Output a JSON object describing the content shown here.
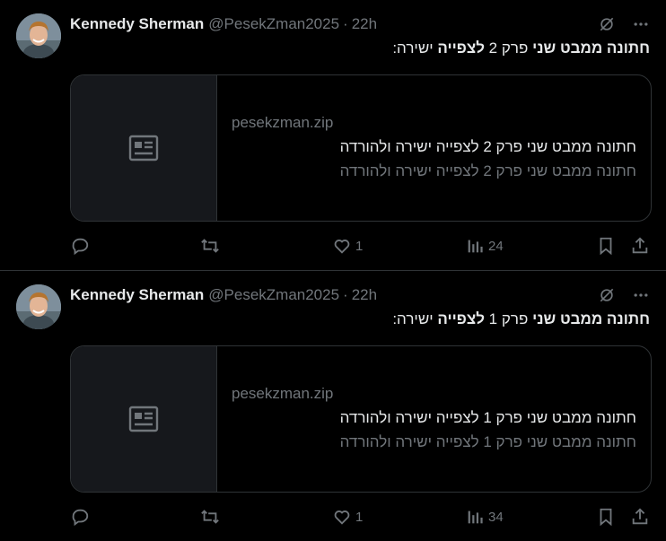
{
  "colors": {
    "background": "#000000",
    "divider": "#2f3336",
    "text_primary": "#e7e9ea",
    "text_secondary": "#71767b",
    "card_thumb": "#16181c"
  },
  "tweets": [
    {
      "author_name": "Kennedy Sherman",
      "author_handle": "@PesekZman2025",
      "separator": "·",
      "time": "22h",
      "text_bold_1": "חתונה ממבט שני",
      "text_mid": " פרק 2 ",
      "text_bold_2": "לצפייה",
      "text_end": " ישירה:",
      "card": {
        "domain": "pesekzman.zip",
        "title": "חתונה ממבט שני פרק 2 לצפייה ישירה ולהורדה",
        "description": "חתונה ממבט שני פרק 2 לצפייה ישירה ולהורדה"
      },
      "actions": {
        "replies": "",
        "retweets": "",
        "likes": "1",
        "views": "24"
      },
      "icons": {
        "grok": "grok-icon",
        "more": "more-icon",
        "reply": "reply-icon",
        "retweet": "retweet-icon",
        "like": "heart-icon",
        "views": "views-icon",
        "bookmark": "bookmark-icon",
        "share": "share-icon",
        "card": "article-icon"
      }
    },
    {
      "author_name": "Kennedy Sherman",
      "author_handle": "@PesekZman2025",
      "separator": "·",
      "time": "22h",
      "text_bold_1": "חתונה ממבט שני",
      "text_mid": " פרק 1 ",
      "text_bold_2": "לצפייה",
      "text_end": " ישירה:",
      "card": {
        "domain": "pesekzman.zip",
        "title": "חתונה ממבט שני פרק 1 לצפייה ישירה ולהורדה",
        "description": "חתונה ממבט שני פרק 1 לצפייה ישירה ולהורדה"
      },
      "actions": {
        "replies": "",
        "retweets": "",
        "likes": "1",
        "views": "34"
      },
      "icons": {
        "grok": "grok-icon",
        "more": "more-icon",
        "reply": "reply-icon",
        "retweet": "retweet-icon",
        "like": "heart-icon",
        "views": "views-icon",
        "bookmark": "bookmark-icon",
        "share": "share-icon",
        "card": "article-icon"
      }
    }
  ]
}
